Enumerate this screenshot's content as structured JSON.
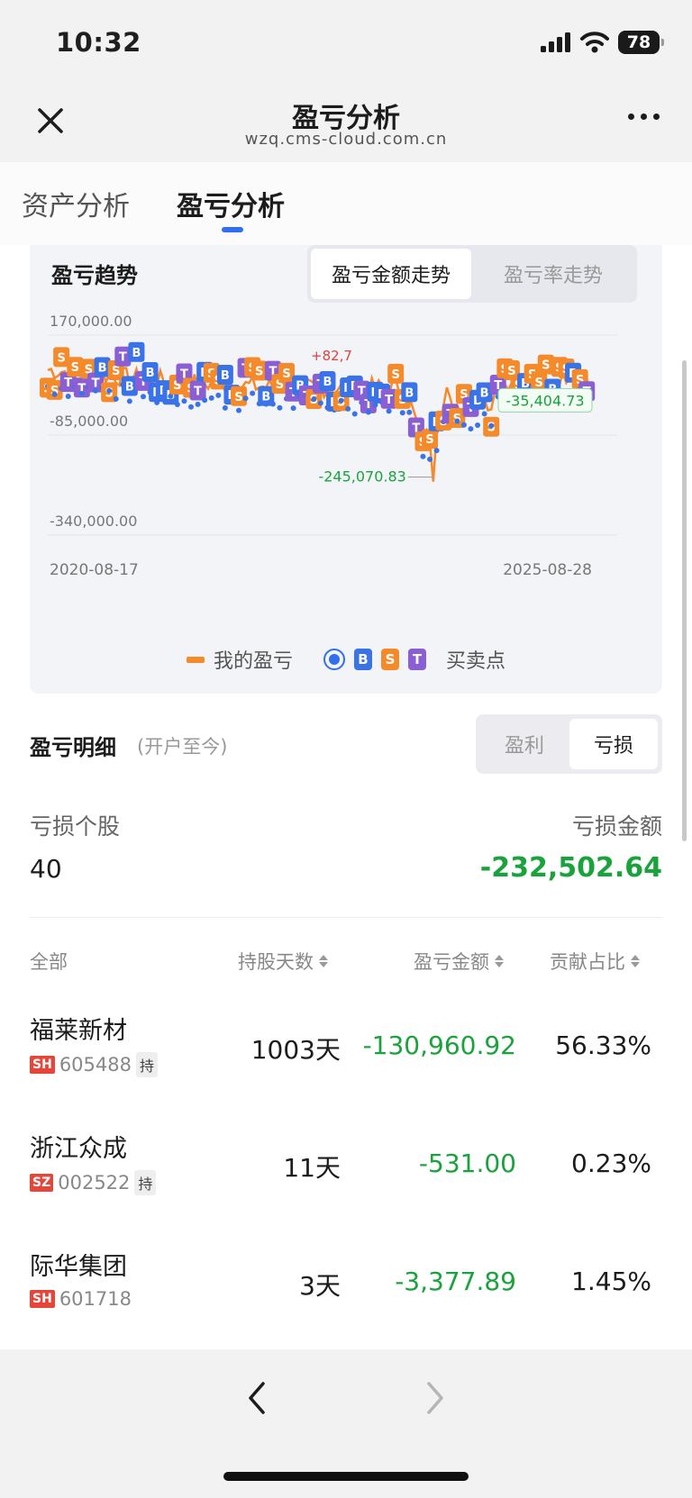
{
  "status_bar": {
    "time": "10:32",
    "battery": "78"
  },
  "nav": {
    "title": "盈亏分析",
    "url": "wzq.cms-cloud.com.cn"
  },
  "tabs": [
    {
      "label": "资产分析",
      "active": false
    },
    {
      "label": "盈亏分析",
      "active": true
    }
  ],
  "trend_card": {
    "title": "盈亏趋势",
    "segment_active": "盈亏金额走势",
    "segment_inactive": "盈亏率走势",
    "legend_my_pnl": "我的盈亏",
    "legend_trade_points": "买卖点",
    "badges": [
      "B",
      "S",
      "T"
    ]
  },
  "chart_data": {
    "type": "line",
    "y_tick_labels": [
      "170,000.00",
      "-85,000.00",
      "-340,000.00"
    ],
    "x_tick_labels": [
      "2020-08-17",
      "2025-08-28"
    ],
    "annotations": {
      "max_label": "+82,7",
      "min_label": "-245,070.83",
      "last_label": "-35,404.73"
    },
    "min_value": -245070.83,
    "last_value": -35404.73,
    "ylim": [
      -340000,
      170000
    ],
    "series_color": "#f58a2b",
    "marker_colors": {
      "B": "#3a72e8",
      "S": "#f58a2b",
      "T": "#8a5fd4"
    },
    "grid": true
  },
  "detail": {
    "title": "盈亏明细",
    "subtitle": "(开户至今)",
    "toggle_profit": "盈利",
    "toggle_loss": "亏损",
    "loss_count_label": "亏损个股",
    "loss_count": "40",
    "loss_amount_label": "亏损金额",
    "loss_amount": "-232,502.64"
  },
  "table": {
    "headers": {
      "all": "全部",
      "days": "持股天数",
      "amount": "盈亏金额",
      "ratio": "贡献占比"
    },
    "rows": [
      {
        "name": "福莱新材",
        "market": "SH",
        "code": "605488",
        "hold": "持",
        "days": "1003天",
        "amount": "-130,960.92",
        "ratio": "56.33%"
      },
      {
        "name": "浙江众成",
        "market": "SZ",
        "code": "002522",
        "hold": "持",
        "days": "11天",
        "amount": "-531.00",
        "ratio": "0.23%"
      },
      {
        "name": "际华集团",
        "market": "SH",
        "code": "601718",
        "hold": "",
        "days": "3天",
        "amount": "-3,377.89",
        "ratio": "1.45%"
      }
    ]
  }
}
